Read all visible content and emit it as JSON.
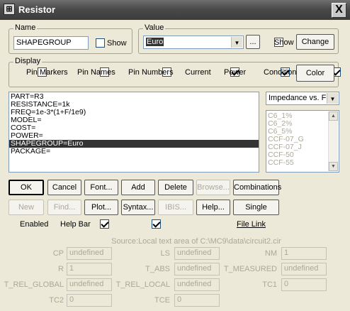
{
  "window": {
    "title": "Resistor",
    "close": "X"
  },
  "name": {
    "legend": "Name",
    "value": "SHAPEGROUP",
    "show_label": "Show",
    "show_checked": false
  },
  "value_group": {
    "legend": "Value",
    "value": "Euro",
    "ellipsis": "...",
    "show_label": "Show",
    "show_checked": false,
    "change_label": "Change"
  },
  "display": {
    "legend": "Display",
    "pin_markers": {
      "label": "Pin Markers",
      "checked": false
    },
    "pin_names": {
      "label": "Pin Names",
      "checked": false
    },
    "pin_numbers": {
      "label": "Pin Numbers",
      "checked": false
    },
    "current": {
      "label": "Current",
      "checked": true
    },
    "power": {
      "label": "Power",
      "checked": true
    },
    "condition": {
      "label": "Condition",
      "checked": true
    },
    "color_label": "Color"
  },
  "attributes": [
    "PART=R3",
    "RESISTANCE=1k",
    "FREQ=1e-3*(1+F/1e9)",
    "MODEL=",
    "COST=",
    "POWER=",
    "SHAPEGROUP=Euro",
    "PACKAGE="
  ],
  "selected_attribute_index": 6,
  "plot_select": {
    "value": "Impedance vs. F"
  },
  "models": [
    "C6_1%",
    "C6_2%",
    "C6_5%",
    "CCF-07_G",
    "CCF-07_J",
    "CCF-50",
    "CCF-55"
  ],
  "buttons_row1": {
    "ok": "OK",
    "cancel": "Cancel",
    "font": "Font...",
    "add": "Add",
    "delete": "Delete",
    "browse": "Browse...",
    "combinations": "Combinations"
  },
  "buttons_row2": {
    "new": "New",
    "find": "Find...",
    "plot": "Plot...",
    "syntax": "Syntax...",
    "ibis": "IBIS...",
    "help": "Help...",
    "single": "Single"
  },
  "enabled": {
    "label": "Enabled",
    "checked": true
  },
  "help_bar": {
    "label": "Help Bar",
    "checked": true
  },
  "file_link": "File Link",
  "source": "Source:Local text area of C:\\MC9\\data\\circuit2.cir",
  "params": {
    "cp": {
      "label": "CP",
      "value": "undefined"
    },
    "ls": {
      "label": "LS",
      "value": "undefined"
    },
    "nm": {
      "label": "NM",
      "value": "1"
    },
    "r": {
      "label": "R",
      "value": "1"
    },
    "t_abs": {
      "label": "T_ABS",
      "value": "undefined"
    },
    "t_measured": {
      "label": "T_MEASURED",
      "value": "undefined"
    },
    "t_rel_global": {
      "label": "T_REL_GLOBAL",
      "value": "undefined"
    },
    "t_rel_local": {
      "label": "T_REL_LOCAL",
      "value": "undefined"
    },
    "tc1": {
      "label": "TC1",
      "value": "0"
    },
    "tc2": {
      "label": "TC2",
      "value": "0"
    },
    "tce": {
      "label": "TCE",
      "value": "0"
    }
  }
}
